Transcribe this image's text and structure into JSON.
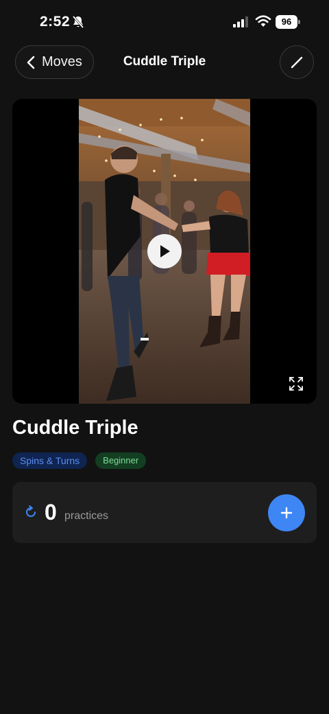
{
  "status_bar": {
    "time": "2:52",
    "battery": "96",
    "icons": [
      "bell-slash-icon",
      "cellular-signal-icon",
      "wifi-icon",
      "battery-icon"
    ]
  },
  "nav": {
    "back_label": "Moves",
    "title": "Cuddle Triple",
    "back_icon": "chevron-left-icon",
    "edit_icon": "pencil-icon"
  },
  "video": {
    "play_icon": "play-icon",
    "expand_icon": "expand-arrows-icon"
  },
  "move": {
    "title": "Cuddle Triple",
    "tags": {
      "category": "Spins & Turns",
      "level": "Beginner"
    }
  },
  "practices": {
    "count": "0",
    "label": "practices",
    "icon": "refresh-icon",
    "add_icon": "plus-icon"
  },
  "colors": {
    "background": "#121212",
    "card": "#1e1e1e",
    "accent": "#3e86f4",
    "category_tag_bg": "#0f2450",
    "category_tag_text": "#5b8ef2",
    "level_tag_bg": "#133e22",
    "level_tag_text": "#7fdc98"
  }
}
